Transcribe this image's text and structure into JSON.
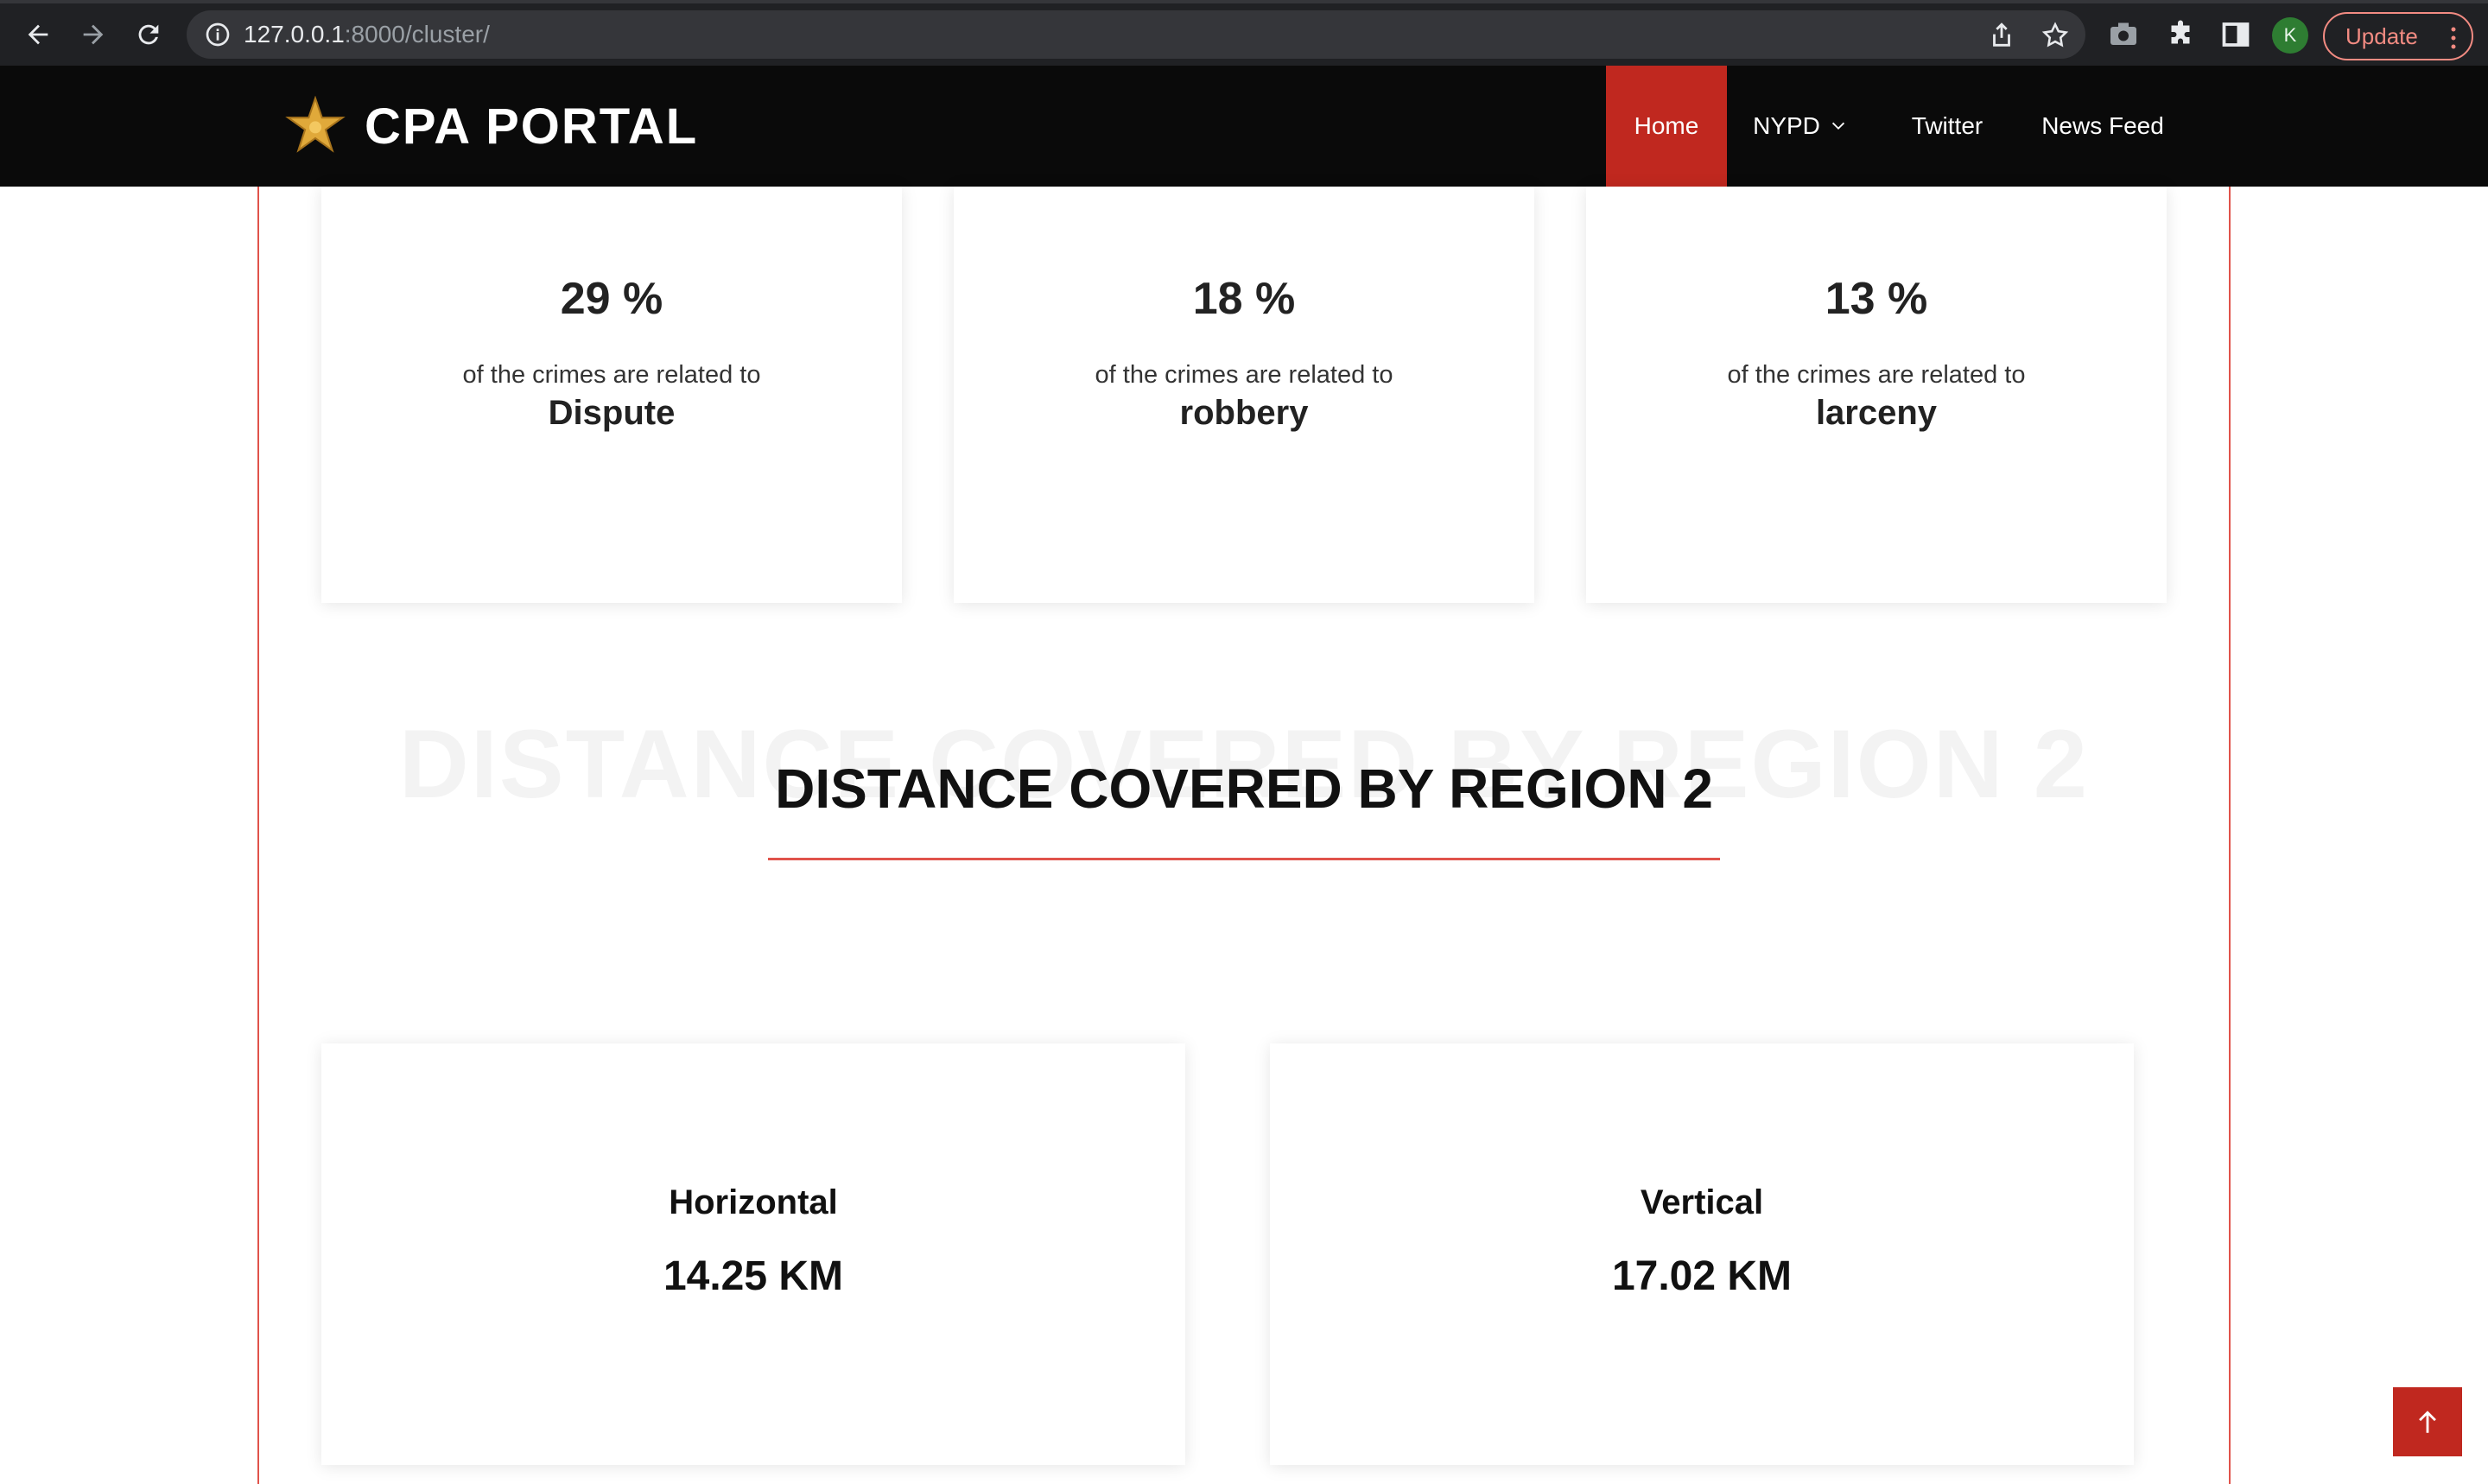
{
  "browser": {
    "url_host": "127.0.0.1",
    "url_path": ":8000/cluster/",
    "avatar_letter": "K",
    "update_label": "Update"
  },
  "site": {
    "brand": "CPA PORTAL",
    "menu": [
      {
        "label": "Home",
        "active": true
      },
      {
        "label": "NYPD",
        "dropdown": true
      },
      {
        "label": "Twitter"
      },
      {
        "label": "News Feed"
      }
    ]
  },
  "crime_stats": [
    {
      "percent": "29 %",
      "text": "of the crimes are related to",
      "category": "Dispute"
    },
    {
      "percent": "18 %",
      "text": "of the crimes are related to",
      "category": "robbery"
    },
    {
      "percent": "13 %",
      "text": "of the crimes are related to",
      "category": "larceny"
    }
  ],
  "distance_section": {
    "title": "DISTANCE COVERED BY REGION 2",
    "items": [
      {
        "label": "Horizontal",
        "value": "14.25 KM"
      },
      {
        "label": "Vertical",
        "value": "17.02 KM"
      }
    ]
  },
  "colors": {
    "accent": "#c0281f",
    "navbar": "#0a0a0a",
    "divider": "#e0534b"
  }
}
